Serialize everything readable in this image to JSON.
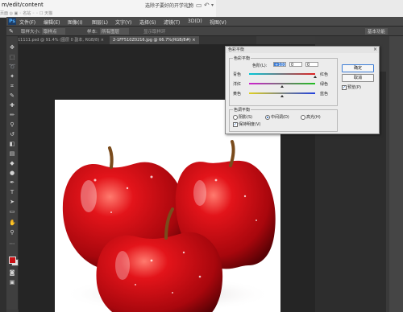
{
  "browser": {
    "url": "m/edit/content",
    "tab_title": "选除子要好的开学礼物",
    "bookmarks": "页面  ◎  ▣  ◦ 名站  ◦  ◦  ☐ 天猫",
    "icons": [
      "clipboard-icon",
      "phone-icon",
      "undo-icon",
      "dropdown-icon"
    ]
  },
  "photoshop": {
    "logo": "Ps",
    "menu": [
      "文件(F)",
      "编辑(E)",
      "图像(I)",
      "图层(L)",
      "文字(Y)",
      "选择(S)",
      "滤镜(T)",
      "3D(D)",
      "视图(V)",
      "窗口(W)",
      "帮助(H)"
    ],
    "options": {
      "sample_size_label": "取样大小:",
      "sample_size_value": "取样点",
      "sample_label": "样本:",
      "sample_value": "所有图层",
      "show_ring": "显示取样环"
    },
    "workspace": "基本功能",
    "tabs": [
      "11111.psd @ 91.4% (图层 0 副本, RGB/8) ×",
      "2-1FF510Z0216.jpg @ 66.7%(RGB/8#) ×"
    ]
  },
  "dialog": {
    "title": "色彩平衡",
    "close": "×",
    "group1_title": "色彩平衡",
    "levels_label": "色阶(L):",
    "levels": [
      "+100",
      "0",
      "0"
    ],
    "sliders": [
      {
        "left": "青色",
        "right": "红色",
        "level": 100
      },
      {
        "left": "洋红",
        "right": "绿色",
        "level": 0
      },
      {
        "left": "黄色",
        "right": "蓝色",
        "level": 0
      }
    ],
    "group2_title": "色调平衡",
    "tones": [
      "阴影(S)",
      "中间调(D)",
      "高光(H)"
    ],
    "selected_tone": "中间调(D)",
    "preserve_luminosity": "保持明度(V)",
    "ok": "确定",
    "cancel": "取消",
    "preview": "预览(P)"
  },
  "colors": {
    "foreground": "#c81014",
    "background": "#e0e0e0",
    "accent": "#3d7dd6"
  }
}
